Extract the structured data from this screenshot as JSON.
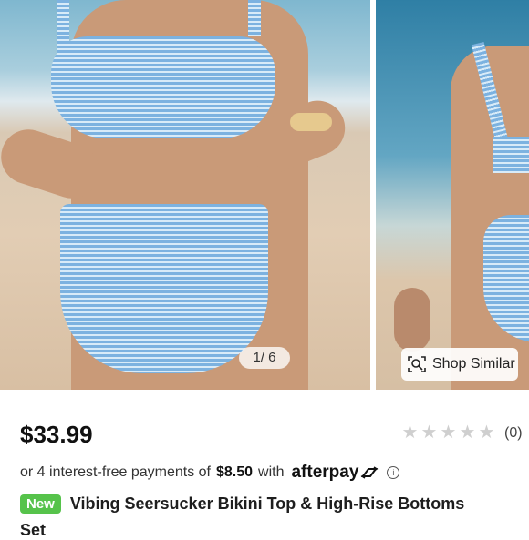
{
  "gallery": {
    "counter": "1/ 6",
    "shop_similar_label": "Shop Similar"
  },
  "product": {
    "price": "$33.99",
    "rating_count": "(0)",
    "stars": 0,
    "installments": {
      "prefix": "or 4 interest-free payments of",
      "amount": "$8.50",
      "mid": "with",
      "provider": "afterpay"
    },
    "badge": "New",
    "title": "Vibing Seersucker Bikini Top & High-Rise Bottoms",
    "title_cont": "Set"
  },
  "colors": {
    "badge_green": "#56c34b",
    "swim_blue": "#7cb2e0",
    "star_empty": "#cfcfcf"
  }
}
